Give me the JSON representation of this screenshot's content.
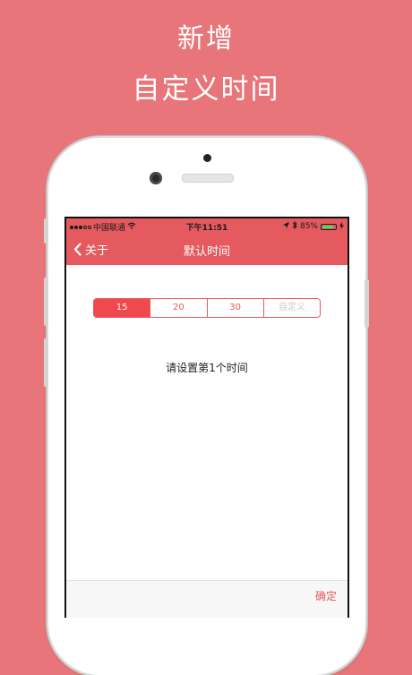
{
  "promo": {
    "line1": "新增",
    "line2": "自定义时间"
  },
  "status_bar": {
    "carrier": "中国联通",
    "time": "下午11:51",
    "battery": "85%",
    "battery_level": 0.85
  },
  "nav": {
    "back_label": "关于",
    "title": "默认时间"
  },
  "segments": [
    {
      "label": "15",
      "selected": true
    },
    {
      "label": "20",
      "selected": false
    },
    {
      "label": "30",
      "selected": false
    },
    {
      "label": "自定义",
      "selected": false,
      "disabled": true
    }
  ],
  "prompt": "请设置第1个时间",
  "footer": {
    "confirm_label": "确定"
  },
  "colors": {
    "background": "#e8757a",
    "accent": "#e55a5e",
    "selected": "#f0484f"
  }
}
